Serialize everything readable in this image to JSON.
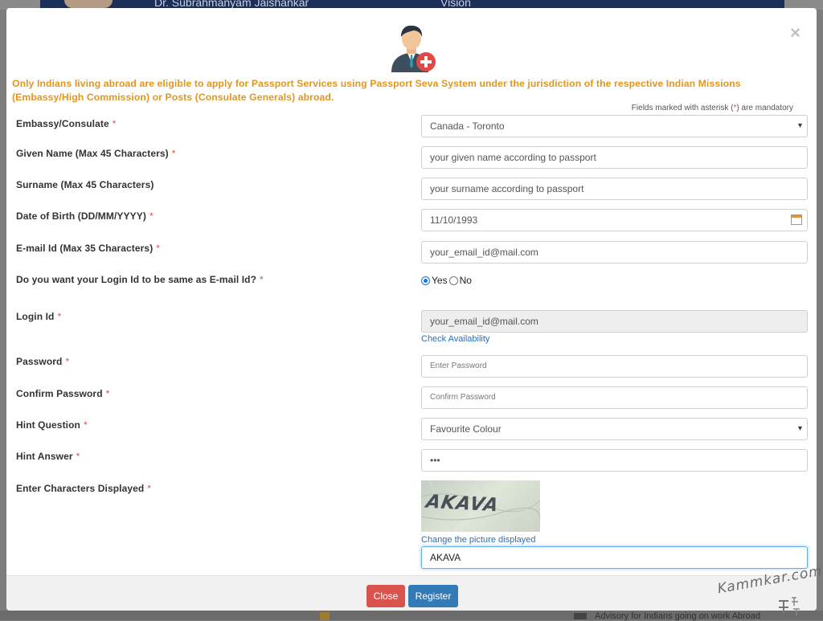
{
  "background": {
    "banner_name": "Dr. Subrahmanyam Jaishankar",
    "banner_vision": "Vision",
    "bottom_text": "Advisory for Indians going on work Abroad"
  },
  "modal": {
    "close_symbol": "×",
    "notice": "Only Indians living abroad are eligible to apply for Passport Services using Passport Seva System under the jurisdiction of the respective Indian Missions (Embassy/High Commission) or Posts (Consulate Generals) abroad.",
    "mandatory_prefix": "Fields marked with asterisk (",
    "mandatory_ast": "*",
    "mandatory_suffix": ") are mandatory"
  },
  "form": {
    "embassy": {
      "label": "Embassy/Consulate",
      "value": "Canada - Toronto"
    },
    "given_name": {
      "label": "Given Name (Max 45 Characters)",
      "value": "your given name according to passport"
    },
    "surname": {
      "label": "Surname (Max 45 Characters)",
      "value": "your surname according to passport"
    },
    "dob": {
      "label": "Date of Birth (DD/MM/YYYY)",
      "value": "11/10/1993"
    },
    "email": {
      "label": "E-mail Id (Max 35 Characters)",
      "value": "your_email_id@mail.com"
    },
    "same_login": {
      "label": "Do you want your Login Id to be same as E-mail Id?",
      "yes": "Yes",
      "no": "No",
      "selected": "Yes"
    },
    "login_id": {
      "label": "Login Id",
      "value": "your_email_id@mail.com",
      "check_link": "Check Availability"
    },
    "password": {
      "label": "Password",
      "placeholder": "Enter Password"
    },
    "confirm_password": {
      "label": "Confirm Password",
      "placeholder": "Confirm Password"
    },
    "hint_question": {
      "label": "Hint Question",
      "value": "Favourite Colour"
    },
    "hint_answer": {
      "label": "Hint Answer",
      "value": "•••"
    },
    "captcha": {
      "label": "Enter Characters Displayed",
      "image_text": "AKAVA",
      "change_link": "Change the picture displayed",
      "value": "AKAVA"
    },
    "required_mark": "*"
  },
  "footer": {
    "close_label": "Close",
    "register_label": "Register"
  },
  "watermark": {
    "text": "Kammkar.com"
  },
  "colors": {
    "notice": "#e0961f",
    "danger": "#d9534f",
    "primary": "#337ab7",
    "link": "#2a6fb6"
  },
  "icons": [
    "user-add-icon",
    "close-icon",
    "chevron-down-icon",
    "calendar-icon"
  ]
}
